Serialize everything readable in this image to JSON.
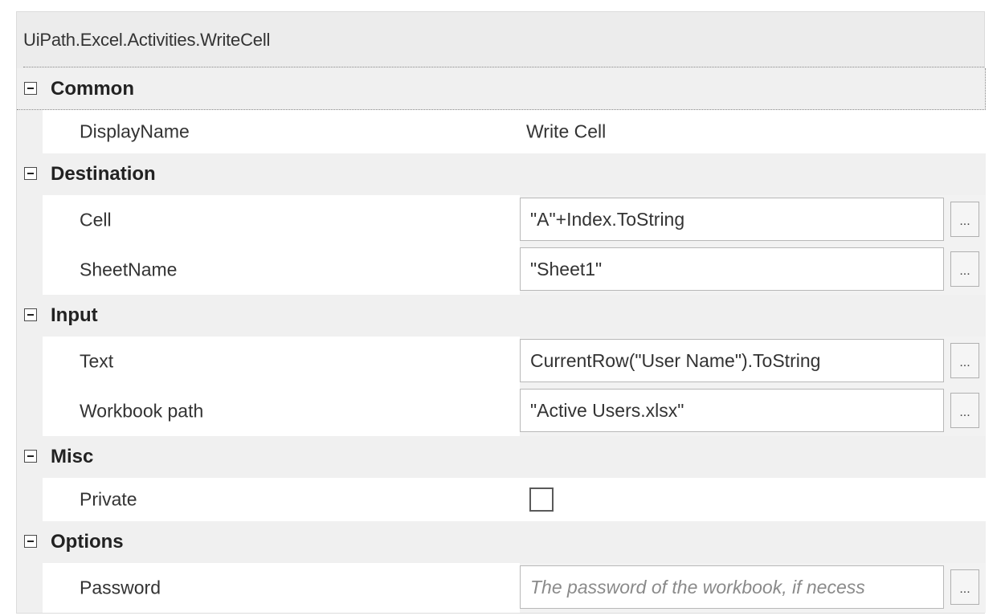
{
  "header": {
    "title": "UiPath.Excel.Activities.WriteCell"
  },
  "categories": [
    {
      "label": "Common",
      "rows": [
        {
          "name": "DisplayName",
          "value": "Write Cell"
        }
      ]
    },
    {
      "label": "Destination",
      "rows": [
        {
          "name": "Cell",
          "value": "\"A\"+Index.ToString",
          "button": "..."
        },
        {
          "name": "SheetName",
          "value": "\"Sheet1\"",
          "button": "..."
        }
      ]
    },
    {
      "label": "Input",
      "rows": [
        {
          "name": "Text",
          "value": "CurrentRow(\"User Name\").ToString",
          "button": "..."
        },
        {
          "name": "Workbook path",
          "value": "\"Active Users.xlsx\"",
          "button": "..."
        }
      ]
    },
    {
      "label": "Misc",
      "rows": [
        {
          "name": "Private",
          "checked": false
        }
      ]
    },
    {
      "label": "Options",
      "rows": [
        {
          "name": "Password",
          "placeholder": "The password of the workbook, if necess",
          "button": "..."
        }
      ]
    }
  ],
  "icons": {
    "collapse": "minus-box-icon"
  },
  "colors": {
    "panel_bg": "#f0f0f0",
    "name_bg": "#ffffff",
    "input_border": "#b8b8b8"
  }
}
